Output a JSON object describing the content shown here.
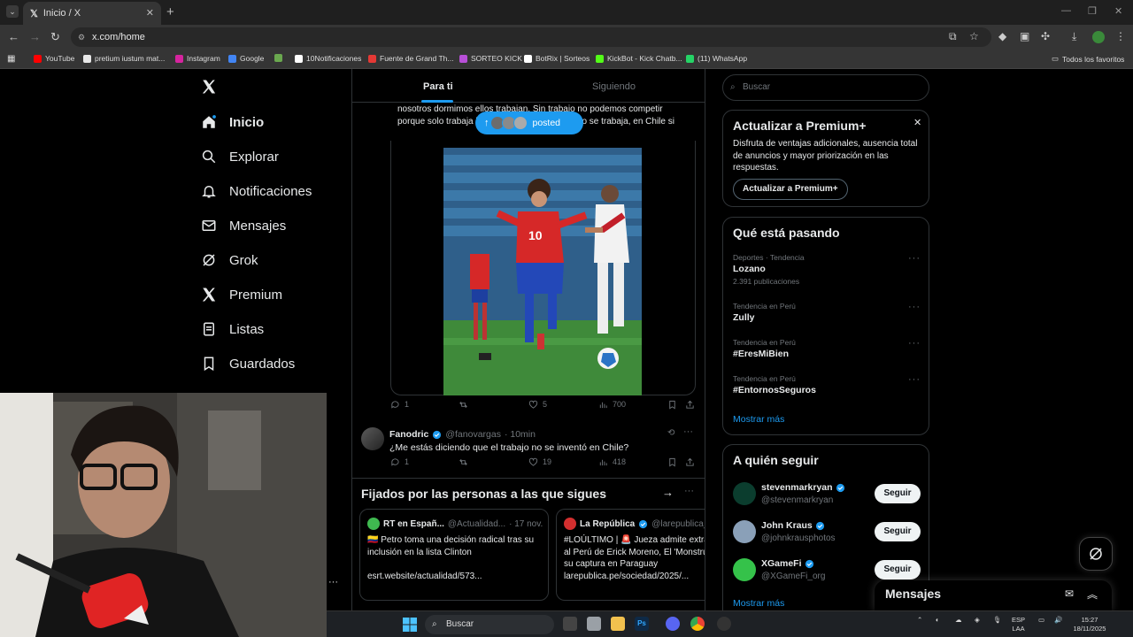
{
  "browser": {
    "tab_title": "Inicio / X",
    "tab_close": "✕",
    "new_tab": "+",
    "url": "x.com/home",
    "bookmarks": [
      {
        "label": "YouTube",
        "color": "#ff0000"
      },
      {
        "label": "pretium iustum mat...",
        "color": "#e8e8e8"
      },
      {
        "label": "Instagram",
        "color": "#d6249f"
      },
      {
        "label": "Google",
        "color": "#4285f4"
      },
      {
        "label": "",
        "color": "#6aa84f"
      },
      {
        "label": "10Notificaciones",
        "color": "#ffffff"
      },
      {
        "label": "Fuente de Grand Th...",
        "color": "#e53935"
      },
      {
        "label": "SORTEO KICK",
        "color": "#b84fd8"
      },
      {
        "label": "BotRix | Sorteos",
        "color": "#ffffff"
      },
      {
        "label": "KickBot - Kick Chatb...",
        "color": "#53fc18"
      },
      {
        "label": "(11) WhatsApp",
        "color": "#25d366"
      }
    ],
    "all_bookmarks": "Todos los favoritos"
  },
  "nav": {
    "items": [
      {
        "label": "Inicio",
        "icon": "home-icon",
        "active": true
      },
      {
        "label": "Explorar",
        "icon": "search-icon"
      },
      {
        "label": "Notificaciones",
        "icon": "bell-icon"
      },
      {
        "label": "Mensajes",
        "icon": "mail-icon"
      },
      {
        "label": "Grok",
        "icon": "grok-icon"
      },
      {
        "label": "Premium",
        "icon": "x-logo-icon"
      },
      {
        "label": "Listas",
        "icon": "list-icon"
      },
      {
        "label": "Guardados",
        "icon": "bookmark-icon"
      }
    ]
  },
  "timeline": {
    "tabs": [
      "Para ti",
      "Siguiendo"
    ],
    "tweet_text": "nosotros dormimos ellos trabajan. Sin trabajo no podemos competir porque solo trabaja los otros países. En Perú no se trabaja, en Chile si",
    "posted_pill": "posted",
    "tweet_stats": {
      "replies": "1",
      "retweets": "",
      "likes": "5",
      "views": "700"
    },
    "reply": {
      "name": "Fanodric",
      "handle": "@fanovargas",
      "time": "· 10min",
      "text": "¿Me estás diciendo que el trabajo no se inventó en Chile?",
      "stats": {
        "replies": "1",
        "retweets": "",
        "likes": "19",
        "views": "418"
      }
    },
    "pinned": {
      "title": "Fijados por las personas a las que sigues",
      "cards": [
        {
          "name": "RT en Españ...",
          "handle": "@Actualidad...",
          "date": "· 17 nov.",
          "logo_color": "#3fb950",
          "text": "🇨🇴 Petro toma una decisión radical tras su inclusión en la lista Clinton\n\nesrt.website/actualidad/573..."
        },
        {
          "name": "La República",
          "handle": "@larepublica_",
          "date": "",
          "logo_color": "#d32f2f",
          "text": "#LOÚLTIMO | 🚨 Jueza admite extra al Perú de Erick Moreno, El 'Monstru su captura en Paraguay\nlarepublica.pe/sociedad/2025/..."
        }
      ]
    }
  },
  "sidebar": {
    "search_placeholder": "Buscar",
    "premium": {
      "title": "Actualizar a Premium+",
      "text": "Disfruta de ventajas adicionales, ausencia total de anuncios y mayor priorización en las respuestas.",
      "button": "Actualizar a Premium+"
    },
    "trends": {
      "title": "Qué está pasando",
      "items": [
        {
          "category": "Deportes · Tendencia",
          "name": "Lozano",
          "count": "2.391 publicaciones"
        },
        {
          "category": "Tendencia en Perú",
          "name": "Zully",
          "count": ""
        },
        {
          "category": "Tendencia en Perú",
          "name": "#EresMiBien",
          "count": ""
        },
        {
          "category": "Tendencia en Perú",
          "name": "#EntornosSeguros",
          "count": ""
        }
      ],
      "show_more": "Mostrar más"
    },
    "who_to_follow": {
      "title": "A quién seguir",
      "items": [
        {
          "name": "stevenmarkryan",
          "handle": "@stevenmarkryan",
          "button": "Seguir",
          "avatar_color": "#0b3d2e"
        },
        {
          "name": "John Kraus",
          "handle": "@johnkrausphotos",
          "button": "Seguir",
          "avatar_color": "#8aa0b8"
        },
        {
          "name": "XGameFi",
          "handle": "@XGameFi_org",
          "button": "Seguir",
          "avatar_color": "#35c24a"
        }
      ],
      "show_more": "Mostrar más"
    },
    "messages_dock": "Mensajes"
  },
  "taskbar": {
    "search_placeholder": "Buscar",
    "lang_top": "ESP",
    "lang_bottom": "LAA",
    "time": "15:27",
    "date": "18/11/2025"
  },
  "colors": {
    "accent": "#1d9bf0",
    "border": "#2f3336",
    "muted": "#71767b"
  }
}
